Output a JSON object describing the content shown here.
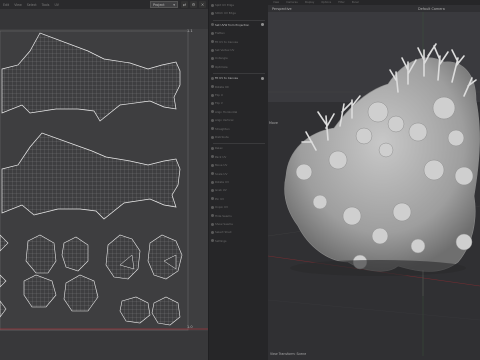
{
  "uv_editor": {
    "menus": [
      "Edit",
      "View",
      "Select",
      "Tools",
      "UV"
    ],
    "projection_dropdown": "Project",
    "corner_top_right": "1.1",
    "corner_bottom_right": "1.0"
  },
  "tool_menu": {
    "items": [
      {
        "label": "Split UV Edge",
        "bright": false
      },
      {
        "label": "Stitch UV Edge",
        "bright": false
      },
      {
        "label": "Set UVW from Projection",
        "bright": true,
        "dot": true
      },
      {
        "label": "Flatten",
        "bright": false
      },
      {
        "label": "Fit UV to Canvas",
        "bright": false
      },
      {
        "label": "Set Vertex UV",
        "bright": false
      },
      {
        "label": "Untangle",
        "bright": false
      },
      {
        "label": "Optimize",
        "bright": false
      },
      {
        "label": "Fit UV to Canvas",
        "bright": true,
        "dot": true
      },
      {
        "label": "Rotate 90",
        "bright": false
      },
      {
        "label": "Flip U",
        "bright": false
      },
      {
        "label": "Flip V",
        "bright": false
      },
      {
        "label": "Align Horizontal",
        "bright": false
      },
      {
        "label": "Align Vertical",
        "bright": false
      },
      {
        "label": "Straighten",
        "bright": false
      },
      {
        "label": "Distribute",
        "bright": false
      },
      {
        "label": "Relax",
        "bright": false
      },
      {
        "label": "Pack UV",
        "bright": false
      },
      {
        "label": "Move UV",
        "bright": false
      },
      {
        "label": "Scale UV",
        "bright": false
      },
      {
        "label": "Rotate UV",
        "bright": false
      },
      {
        "label": "Grab UV",
        "bright": false
      },
      {
        "label": "Pin UV",
        "bright": false
      },
      {
        "label": "Unpin UV",
        "bright": false
      },
      {
        "label": "Hide Seams",
        "bright": false
      },
      {
        "label": "Show Seams",
        "bright": false
      },
      {
        "label": "Select Shell",
        "bright": false
      },
      {
        "label": "Settings",
        "bright": false
      }
    ]
  },
  "viewport": {
    "menubar": [
      "View",
      "Cameras",
      "Display",
      "Options",
      "Filter",
      "Panel"
    ],
    "projection_label": "Perspective",
    "camera_label": "Default Camera",
    "mode_label": "Move",
    "footer_label": "View Transform: Scene"
  },
  "colors": {
    "uv_bg": "#3e3e40",
    "uv_line": "#e6e6e6",
    "grid_line": "#8a8a8a",
    "axis_red": "#a0343b",
    "model": "#b9b9b9",
    "viewport_bg": "#303033"
  }
}
